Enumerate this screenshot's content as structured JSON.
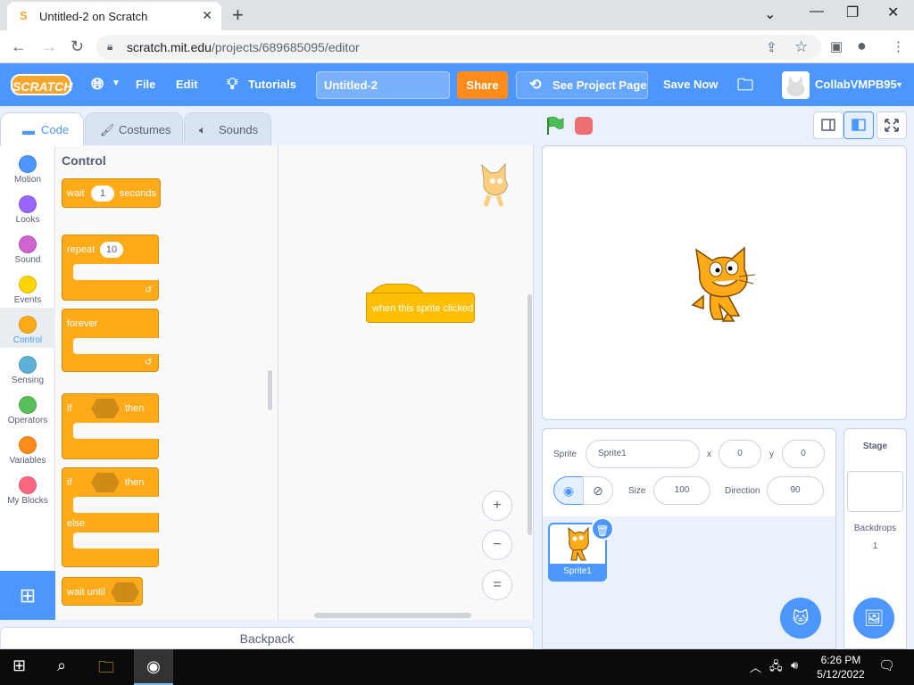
{
  "browser": {
    "tab_title": "Untitled-2 on Scratch",
    "tab_favicon": "S",
    "url_host": "scratch.mit.edu",
    "url_path": "/projects/689685095/editor"
  },
  "menubar": {
    "logo": "SCRATCH",
    "file": "File",
    "edit": "Edit",
    "tutorials": "Tutorials",
    "project_title": "Untitled-2",
    "share": "Share",
    "see_project_page": "See Project Page",
    "save_now": "Save Now",
    "username": "CollabVMPB95"
  },
  "tabs": {
    "code": "Code",
    "costumes": "Costumes",
    "sounds": "Sounds"
  },
  "categories": [
    {
      "label": "Motion",
      "color": "#4c97ff"
    },
    {
      "label": "Looks",
      "color": "#9966ff"
    },
    {
      "label": "Sound",
      "color": "#cf63cf"
    },
    {
      "label": "Events",
      "color": "#ffd500"
    },
    {
      "label": "Control",
      "color": "#ffab19"
    },
    {
      "label": "Sensing",
      "color": "#5cb1d6"
    },
    {
      "label": "Operators",
      "color": "#59c059"
    },
    {
      "label": "Variables",
      "color": "#ff8c1a"
    },
    {
      "label": "My Blocks",
      "color": "#ff6680"
    }
  ],
  "palette": {
    "title": "Control",
    "wait": "wait",
    "wait_value": "1",
    "seconds": "seconds",
    "repeat": "repeat",
    "repeat_value": "10",
    "forever": "forever",
    "if1": "if",
    "then1": "then",
    "if2": "if",
    "then2": "then",
    "else": "else",
    "wait_until": "wait until"
  },
  "script": {
    "hat_block": "when this sprite clicked"
  },
  "zoom": {
    "in": "+",
    "out": "−",
    "reset": "="
  },
  "backpack": "Backpack",
  "sprite_info": {
    "sprite_label": "Sprite",
    "sprite_name": "Sprite1",
    "x_label": "x",
    "x_value": "0",
    "y_label": "y",
    "y_value": "0",
    "size_label": "Size",
    "size_value": "100",
    "direction_label": "Direction",
    "direction_value": "90"
  },
  "sprite_list": [
    {
      "name": "Sprite1"
    }
  ],
  "stage_pane": {
    "title": "Stage",
    "backdrops_label": "Backdrops",
    "backdrops_count": "1"
  },
  "taskbar": {
    "time": "6:26 PM",
    "date": "5/12/2022"
  }
}
